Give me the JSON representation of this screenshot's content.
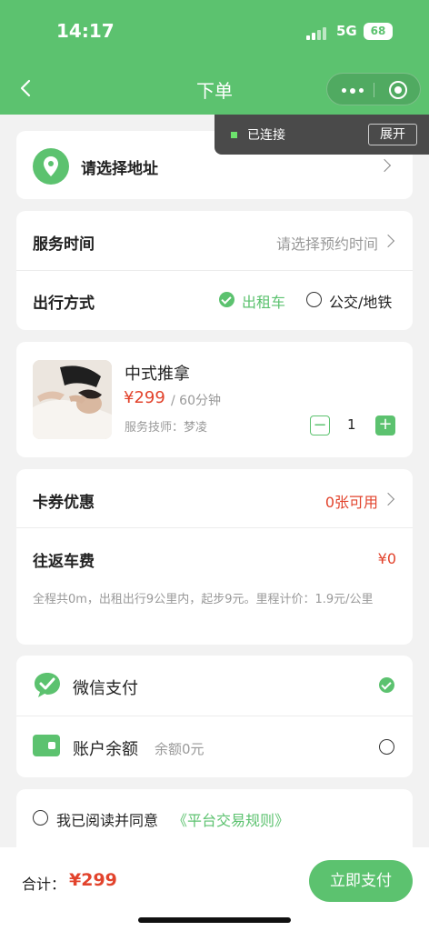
{
  "status_bar": {
    "time": "14:17",
    "network": "5G",
    "battery": "68"
  },
  "nav": {
    "title": "下单"
  },
  "connection": {
    "label": "已连接",
    "expand": "展开"
  },
  "address": {
    "placeholder": "请选择地址"
  },
  "service_time": {
    "label": "服务时间",
    "placeholder": "请选择预约时间"
  },
  "travel": {
    "label": "出行方式",
    "options": [
      {
        "label": "出租车",
        "selected": true
      },
      {
        "label": "公交/地铁",
        "selected": false
      }
    ]
  },
  "service": {
    "name": "中式推拿",
    "price": "¥299",
    "duration": "/ 60分钟",
    "technician": "服务技师：梦凌",
    "quantity": "1",
    "minus": "−",
    "plus": "+"
  },
  "coupon": {
    "label": "卡券优惠",
    "value": "0张可用"
  },
  "fare": {
    "label": "往返车费",
    "value": "¥0",
    "note": "全程共0m，出租出行9公里内，起步9元。里程计价：1.9元/公里"
  },
  "payment": {
    "wechat": {
      "label": "微信支付",
      "selected": true
    },
    "balance": {
      "label": "账户余额",
      "sub": "余额0元",
      "selected": false
    }
  },
  "agreement": {
    "text": "我已阅读并同意",
    "link": "《平台交易规则》"
  },
  "footer": {
    "total_label": "合计：",
    "total_value": "¥299",
    "pay_button": "立即支付"
  },
  "colors": {
    "accent": "#5cc26f",
    "price": "#e2432c"
  }
}
